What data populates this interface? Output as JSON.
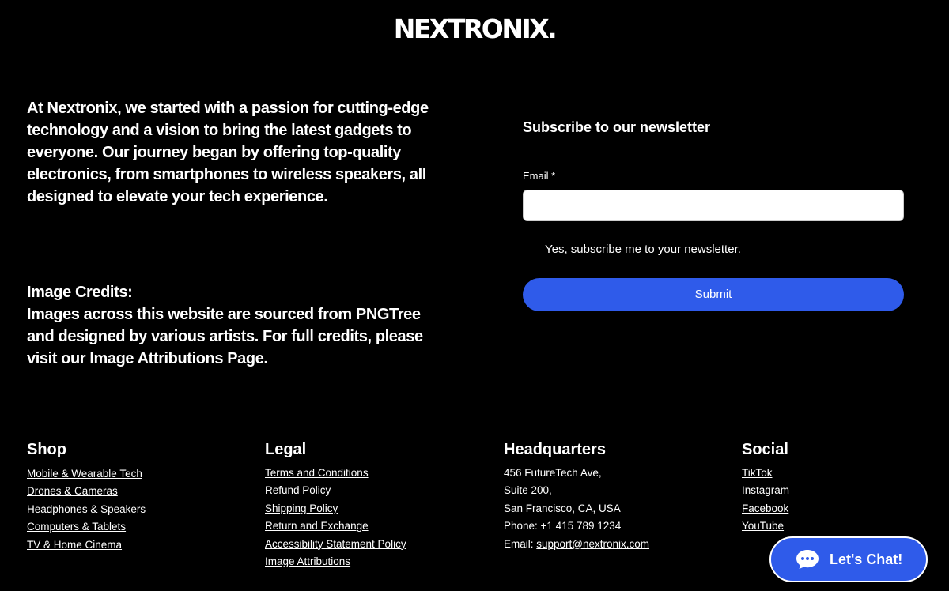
{
  "brand": {
    "logo_text": "NEXTRONIX."
  },
  "about": {
    "text": "At Nextronix, we started with a passion for cutting-edge technology and a vision to bring the latest gadgets to everyone. Our journey began by offering top-quality electronics, from smartphones to wireless speakers, all designed to elevate your tech experience."
  },
  "credits": {
    "heading": "Image Credits:",
    "text": "Images across this website are sourced from PNGTree and designed by various artists. For full credits, please visit our Image Attributions Page."
  },
  "newsletter": {
    "title": "Subscribe to our newsletter",
    "email_label": "Email *",
    "email_value": "",
    "checkbox_label": "Yes, subscribe me to your newsletter.",
    "submit_label": "Submit"
  },
  "footer": {
    "shop": {
      "title": "Shop",
      "links": [
        "Mobile & Wearable Tech",
        "Drones & Cameras",
        "Headphones & Speakers",
        "Computers & Tablets",
        "TV & Home Cinema"
      ]
    },
    "legal": {
      "title": "Legal",
      "links": [
        "Terms and Conditions",
        "Refund Policy",
        "Shipping Policy",
        "Return and Exchange",
        "Accessibility Statement Policy",
        "Image Attributions"
      ]
    },
    "headquarters": {
      "title": "Headquarters",
      "address_line1": "456 FutureTech Ave,",
      "address_line2": "Suite 200,",
      "address_line3": "San Francisco, CA, USA",
      "phone": "Phone: +1 415 789 1234",
      "email_prefix": "Email: ",
      "email_link": "support@nextronix.com"
    },
    "social": {
      "title": "Social",
      "links": [
        "TikTok",
        "Instagram",
        "Facebook",
        "YouTube"
      ]
    }
  },
  "chat": {
    "label": "Let's Chat!",
    "icon": "chat-bubble-icon"
  },
  "colors": {
    "background": "#000000",
    "accent": "#2f5bea",
    "text": "#ffffff"
  }
}
